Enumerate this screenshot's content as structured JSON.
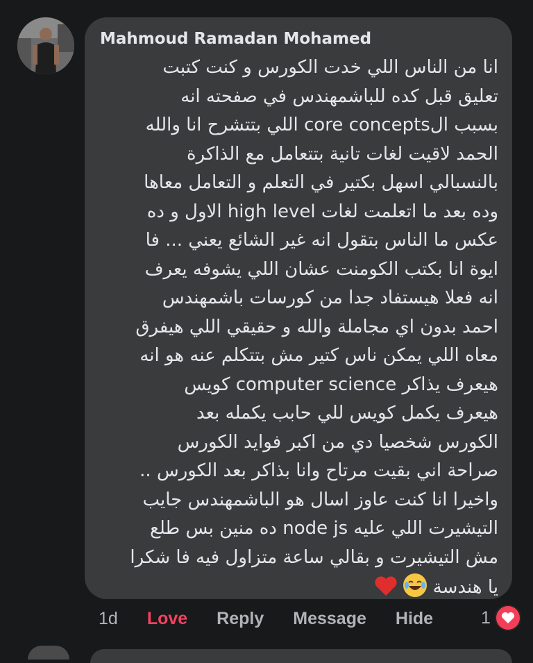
{
  "comment": {
    "author": "Mahmoud Ramadan Mohamed",
    "lines": [
      "انا من الناس اللي خدت الكورس و كنت كتبت",
      "تعليق قبل كده للباشمهندس في صفحته انه",
      "بسبب الcore concepts اللي بتتشرح انا والله",
      "الحمد لاقيت لغات تانية بتتعامل مع الذاكرة",
      "بالنسبالي اسهل بكتير في التعلم و التعامل معاها",
      "وده بعد ما اتعلمت لغات high level الاول و ده",
      "عكس ما الناس بتقول انه غير الشائع يعني ... فا",
      "ايوة انا بكتب الكومنت عشان اللي يشوفه يعرف",
      "انه فعلا هيستفاد جدا من كورسات باشمهندس",
      "احمد بدون اي مجاملة والله و حقيقي اللي هيفرق",
      "معاه اللي يمكن ناس كتير مش بتتكلم عنه هو انه",
      "هيعرف يذاكر computer science كويس",
      "هيعرف يكمل كويس للي حابب يكمله بعد",
      "الكورس شخصيا دي من اكبر فوايد الكورس",
      "صراحة اني بقيت مرتاح وانا بذاكر بعد الكورس ..",
      "واخيرا انا كنت عاوز اسال هو الباشمهندس جايب",
      "التيشيرت اللي عليه node js ده منين بس طلع",
      "مش التيشيرت و بقالي ساعة متزاول فيه فا شكرا",
      "يا هندسة"
    ],
    "emojis": [
      "laughing-emoji",
      "red-heart-emoji"
    ]
  },
  "actions": {
    "time": "1d",
    "love": "Love",
    "reply": "Reply",
    "message": "Message",
    "hide": "Hide"
  },
  "reactions": {
    "count": "1",
    "icon": "heart-icon"
  },
  "colors": {
    "background": "#18191a",
    "bubble": "#3a3b3c",
    "love_active": "#f3425f",
    "heart_badge": "#f33e58"
  }
}
